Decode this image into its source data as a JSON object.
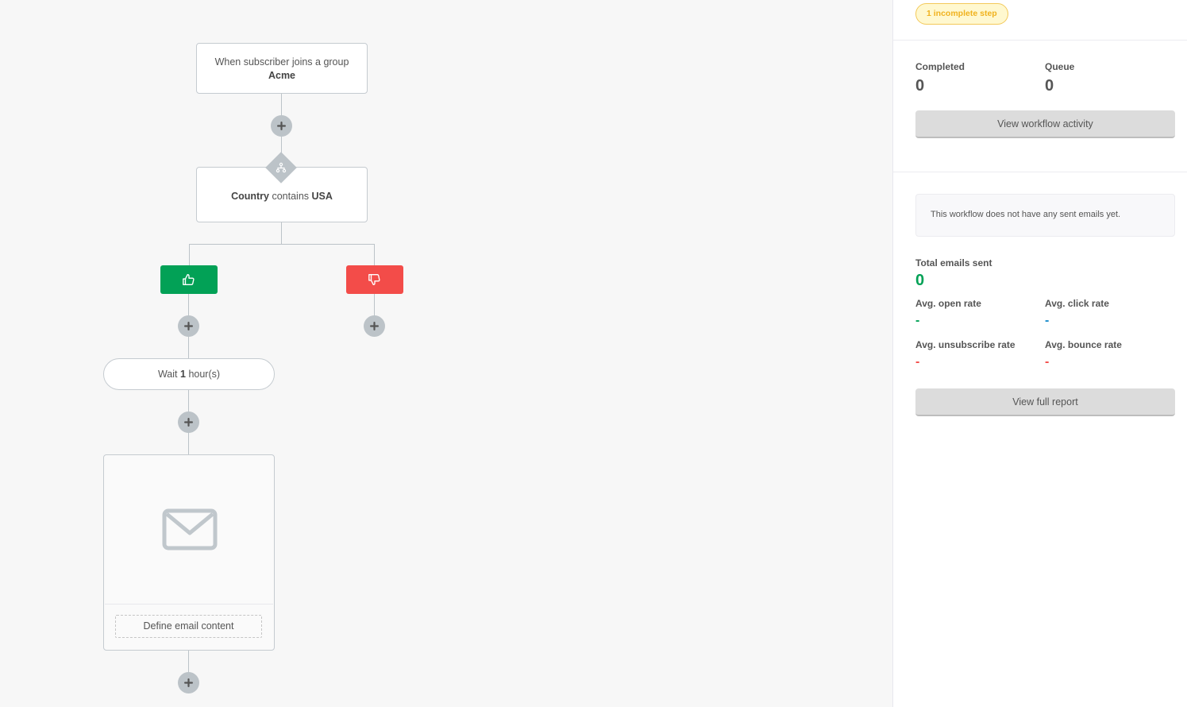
{
  "workflow": {
    "trigger": {
      "label": "When subscriber joins a group",
      "group": "Acme"
    },
    "condition": {
      "field": "Country",
      "operator": "contains",
      "value": "USA"
    },
    "branches": {
      "yes": {
        "icon": "thumbs-up-icon",
        "color": "#02a156"
      },
      "no": {
        "icon": "thumbs-down-icon",
        "color": "#f34c49"
      }
    },
    "delay": {
      "prefix": "Wait",
      "amount": "1",
      "unit": "hour(s)"
    },
    "email": {
      "icon": "envelope-icon",
      "action_label": "Define email content"
    }
  },
  "panel": {
    "badge": "1 incomplete step",
    "completed": {
      "label": "Completed",
      "value": "0"
    },
    "queue": {
      "label": "Queue",
      "value": "0"
    },
    "activity_button": "View workflow activity",
    "notice": "This workflow does not have any sent emails yet.",
    "total_sent": {
      "label": "Total emails sent",
      "value": "0",
      "color": "#02a156"
    },
    "open_rate": {
      "label": "Avg. open rate",
      "value": "-",
      "color": "#02a156"
    },
    "click_rate": {
      "label": "Avg. click rate",
      "value": "-",
      "color": "#1a8ccb"
    },
    "unsubscribe_rate": {
      "label": "Avg. unsubscribe rate",
      "value": "-",
      "color": "#f34c49"
    },
    "bounce_rate": {
      "label": "Avg. bounce rate",
      "value": "-",
      "color": "#f34c49"
    },
    "report_button": "View full report"
  }
}
